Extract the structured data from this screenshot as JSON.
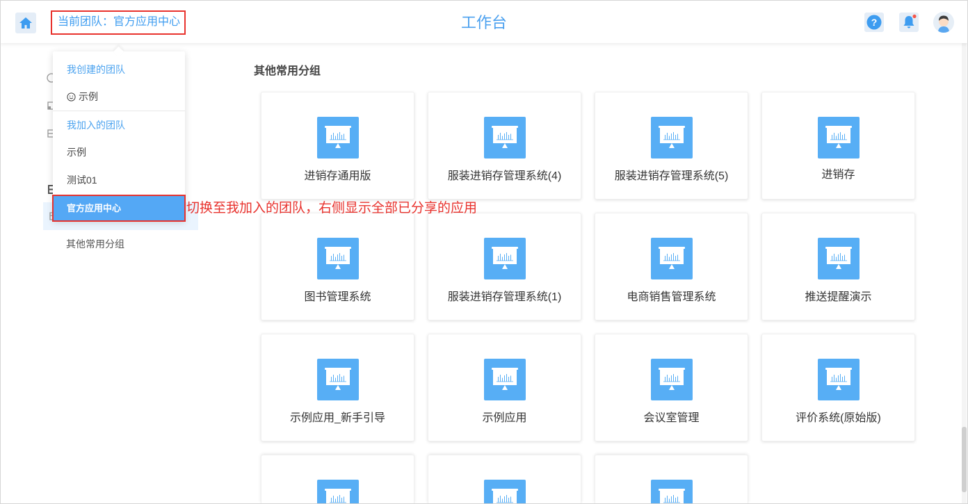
{
  "header": {
    "current_team": "当前团队：官方应用中心",
    "title": "工作台",
    "icons": [
      "home-icon",
      "help-icon",
      "bell-icon",
      "avatar"
    ]
  },
  "team_dropdown": {
    "created_header": "我创建的团队",
    "created_teams": [
      {
        "label": "示例",
        "icon": "smile-icon",
        "selected": false
      }
    ],
    "joined_header": "我加入的团队",
    "joined_teams": [
      {
        "label": "示例",
        "selected": false
      },
      {
        "label": "测试01",
        "selected": false
      },
      {
        "label": "官方应用中心",
        "selected": true
      }
    ]
  },
  "annotation": {
    "text": "切换至我加入的团队，右侧显示全部已分享的应用"
  },
  "sidebar": {
    "icons": [
      "clock-icon",
      "folder-icon",
      "list-icon",
      "grid-icon",
      "folder-icon"
    ],
    "items": [
      {
        "label": "其他常用分组"
      }
    ]
  },
  "main": {
    "group_title": "其他常用分组",
    "apps": [
      {
        "name": "进销存通用版",
        "icon": "presentation-board-icon"
      },
      {
        "name": "服装进销存管理系统(4)",
        "icon": "presentation-board-icon"
      },
      {
        "name": "服装进销存管理系统(5)",
        "icon": "presentation-board-icon"
      },
      {
        "name": "进销存",
        "icon": "presentation-board-icon"
      },
      {
        "name": "图书管理系统",
        "icon": "presentation-board-icon"
      },
      {
        "name": "服装进销存管理系统(1)",
        "icon": "presentation-board-icon"
      },
      {
        "name": "电商销售管理系统",
        "icon": "presentation-board-icon"
      },
      {
        "name": "推送提醒演示",
        "icon": "presentation-board-icon"
      },
      {
        "name": "示例应用_新手引导",
        "icon": "presentation-board-icon"
      },
      {
        "name": "示例应用",
        "icon": "presentation-board-icon"
      },
      {
        "name": "会议室管理",
        "icon": "presentation-board-icon"
      },
      {
        "name": "评价系统(原始版)",
        "icon": "presentation-board-icon"
      }
    ],
    "cut_off_apps": [
      {
        "icon": "presentation-board-icon"
      },
      {
        "icon": "presentation-board-icon"
      },
      {
        "icon": "presentation-board-icon"
      }
    ]
  },
  "colors": {
    "accent": "#3d9cf0",
    "app_icon_bg": "#57aef5",
    "selected_item_bg": "#54a8f5",
    "annotation_red": "#e8322d",
    "notification_dot": "#f5564a",
    "sidebar_active_bg": "#eaf4fe"
  }
}
